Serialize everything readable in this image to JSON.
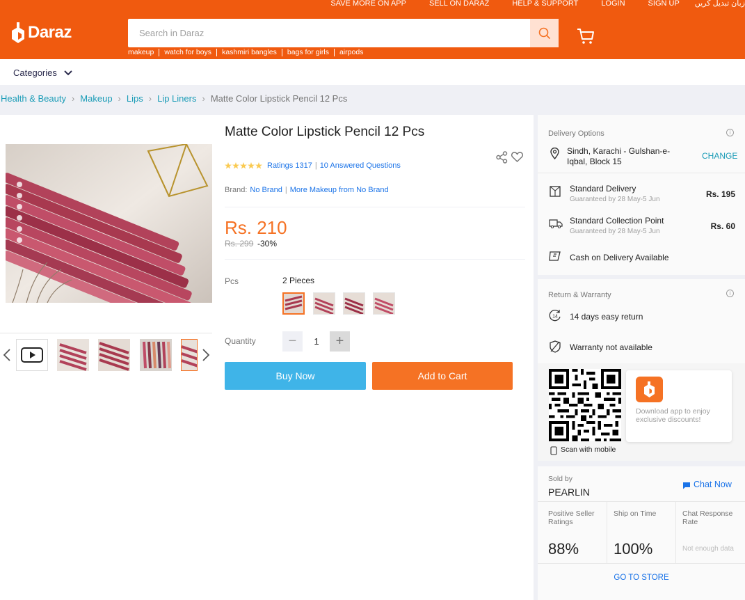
{
  "header": {
    "top_links": [
      "SAVE MORE ON APP",
      "SELL ON DARAZ",
      "HELP & SUPPORT",
      "LOGIN",
      "SIGN UP",
      "زبان تبدیل کریں"
    ],
    "logo_text": "Daraz",
    "search_placeholder": "Search in Daraz",
    "search_hints": [
      "makeup",
      "watch for boys",
      "kashmiri bangles",
      "bags for girls",
      "airpods"
    ],
    "categories_label": "Categories"
  },
  "breadcrumb": {
    "links": [
      "Health & Beauty",
      "Makeup",
      "Lips",
      "Lip Liners"
    ],
    "current": "Matte Color Lipstick Pencil 12 Pcs"
  },
  "product": {
    "title": "Matte Color Lipstick Pencil 12 Pcs",
    "rating_stars": 4.5,
    "ratings_label": "Ratings 1317",
    "questions_label": "10 Answered Questions",
    "brand_label": "Brand:",
    "brand_name": "No Brand",
    "more_from": "More Makeup from No Brand",
    "price": "Rs. 210",
    "old_price": "Rs. 299",
    "discount": "-30%",
    "variation_label": "Pcs",
    "variation_value": "2 Pieces",
    "quantity_label": "Quantity",
    "quantity": "1",
    "buy_now": "Buy Now",
    "add_to_cart": "Add to Cart"
  },
  "delivery": {
    "heading": "Delivery Options",
    "location": "Sindh, Karachi - Gulshan-e-Iqbal, Block 15",
    "change": "CHANGE",
    "options": [
      {
        "name": "Standard Delivery",
        "eta": "Guaranteed by 28 May-5 Jun",
        "fee": "Rs. 195"
      },
      {
        "name": "Standard Collection Point",
        "eta": "Guaranteed by 28 May-5 Jun",
        "fee": "Rs. 60"
      }
    ],
    "cod": "Cash on Delivery Available"
  },
  "warranty": {
    "heading": "Return & Warranty",
    "return": "14 days easy return",
    "warranty": "Warranty not available"
  },
  "app_promo": {
    "scan": "Scan with mobile",
    "download": "Download app to enjoy exclusive discounts!"
  },
  "seller": {
    "sold_by": "Sold by",
    "name": "PEARLIN",
    "chat": "Chat Now",
    "metrics": [
      {
        "label": "Positive Seller Ratings",
        "value": "88%"
      },
      {
        "label": "Ship on Time",
        "value": "100%"
      },
      {
        "label": "Chat Response Rate",
        "value": "Not enough data"
      }
    ],
    "go_to_store": "GO TO STORE"
  },
  "colors": {
    "brand": "#f05a0f",
    "accent": "#f57224",
    "link": "#1a9cb7",
    "buy": "#3fb4e8"
  }
}
